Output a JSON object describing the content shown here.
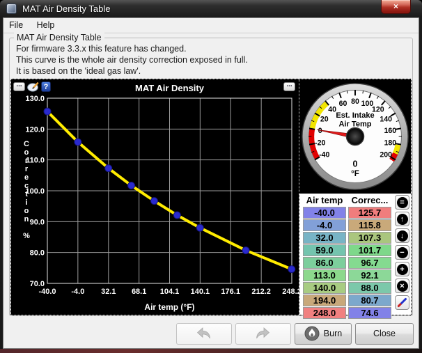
{
  "window": {
    "title": "MAT Air Density Table",
    "close_glyph": "×"
  },
  "menu": {
    "items": [
      "File",
      "Help"
    ]
  },
  "info_box": {
    "title": "MAT Air Density Table",
    "lines": [
      "For firmware 3.3.x this feature has changed.",
      "This curve is the whole air density correction exposed in full.",
      "It is based on the 'ideal gas law'."
    ]
  },
  "chart_toolbar": {
    "dots": "...",
    "help": "?"
  },
  "chart_data": {
    "type": "line",
    "title": "MAT Air Density",
    "xlabel": "Air temp (°F)",
    "ylabel": "Correction %",
    "x": [
      -40,
      -4,
      32,
      59,
      86,
      113,
      140,
      194,
      248
    ],
    "y": [
      125.7,
      115.8,
      107.3,
      101.7,
      96.7,
      92.1,
      88.0,
      80.7,
      74.6
    ],
    "x_ticks": [
      "-40.0",
      "-4.0",
      "32.1",
      "68.1",
      "104.1",
      "140.1",
      "176.1",
      "212.2",
      "248.2"
    ],
    "x_tick_values": [
      -40.0,
      -4.0,
      32.1,
      68.1,
      104.1,
      140.1,
      176.1,
      212.2,
      248.2
    ],
    "y_ticks": [
      "130.0",
      "120.0",
      "110.0",
      "100.0",
      "90.0",
      "80.0",
      "70.0"
    ],
    "xlim": [
      -40,
      248.2
    ],
    "ylim": [
      70,
      130
    ],
    "grid": true,
    "legend": "none",
    "line_color": "#ffec00",
    "point_color": "#2a2ace",
    "background": "#000000"
  },
  "gauge": {
    "title_line1": "Est. Intake",
    "title_line2": "Air Temp",
    "value": "0",
    "units": "°F",
    "min": -40,
    "max": 200,
    "labels": [
      -40,
      -20,
      0,
      20,
      40,
      60,
      80,
      100,
      120,
      140,
      160,
      180,
      200
    ],
    "needle_value": 0,
    "needle_color": "#e31b1b",
    "zones": [
      {
        "from": -40,
        "to": 0,
        "color": "#e00000"
      },
      {
        "from": 0,
        "to": 40,
        "color": "#f2e500"
      },
      {
        "from": 181,
        "to": 193,
        "color": "#f2e500"
      },
      {
        "from": 193,
        "to": 203,
        "color": "#e00000"
      }
    ]
  },
  "table": {
    "headers": [
      "Air temp",
      "Correc..."
    ],
    "rows": [
      {
        "air_temp": "-40.0",
        "correction": "125.7",
        "air_temp_bg": "#8282e8",
        "correction_bg": "#f07d7d"
      },
      {
        "air_temp": "-4.0",
        "correction": "115.8",
        "air_temp_bg": "#82a0d8",
        "correction_bg": "#c9a97a"
      },
      {
        "air_temp": "32.0",
        "correction": "107.3",
        "air_temp_bg": "#78b4c6",
        "correction_bg": "#aac67e"
      },
      {
        "air_temp": "59.0",
        "correction": "101.7",
        "air_temp_bg": "#74c4ae",
        "correction_bg": "#7ed88a"
      },
      {
        "air_temp": "86.0",
        "correction": "96.7",
        "air_temp_bg": "#7cce9c",
        "correction_bg": "#84da90"
      },
      {
        "air_temp": "113.0",
        "correction": "92.1",
        "air_temp_bg": "#8cd88c",
        "correction_bg": "#8cd898"
      },
      {
        "air_temp": "140.0",
        "correction": "88.0",
        "air_temp_bg": "#a8cc82",
        "correction_bg": "#7cc8aa"
      },
      {
        "air_temp": "194.0",
        "correction": "80.7",
        "air_temp_bg": "#c8a87a",
        "correction_bg": "#7ca8cc"
      },
      {
        "air_temp": "248.0",
        "correction": "74.6",
        "air_temp_bg": "#f08080",
        "correction_bg": "#8282e8"
      }
    ]
  },
  "side_buttons": [
    {
      "name": "equal",
      "glyph": "=",
      "kind": "circle"
    },
    {
      "name": "arrow-up",
      "glyph": "↑",
      "kind": "circle"
    },
    {
      "name": "arrow-down",
      "glyph": "↓",
      "kind": "circle"
    },
    {
      "name": "minus",
      "glyph": "−",
      "kind": "circle"
    },
    {
      "name": "plus",
      "glyph": "+",
      "kind": "circle"
    },
    {
      "name": "multiply",
      "glyph": "×",
      "kind": "circle"
    },
    {
      "name": "edit-pencil",
      "glyph": "",
      "kind": "pencil"
    }
  ],
  "footer": {
    "burn": "Burn",
    "close": "Close"
  }
}
